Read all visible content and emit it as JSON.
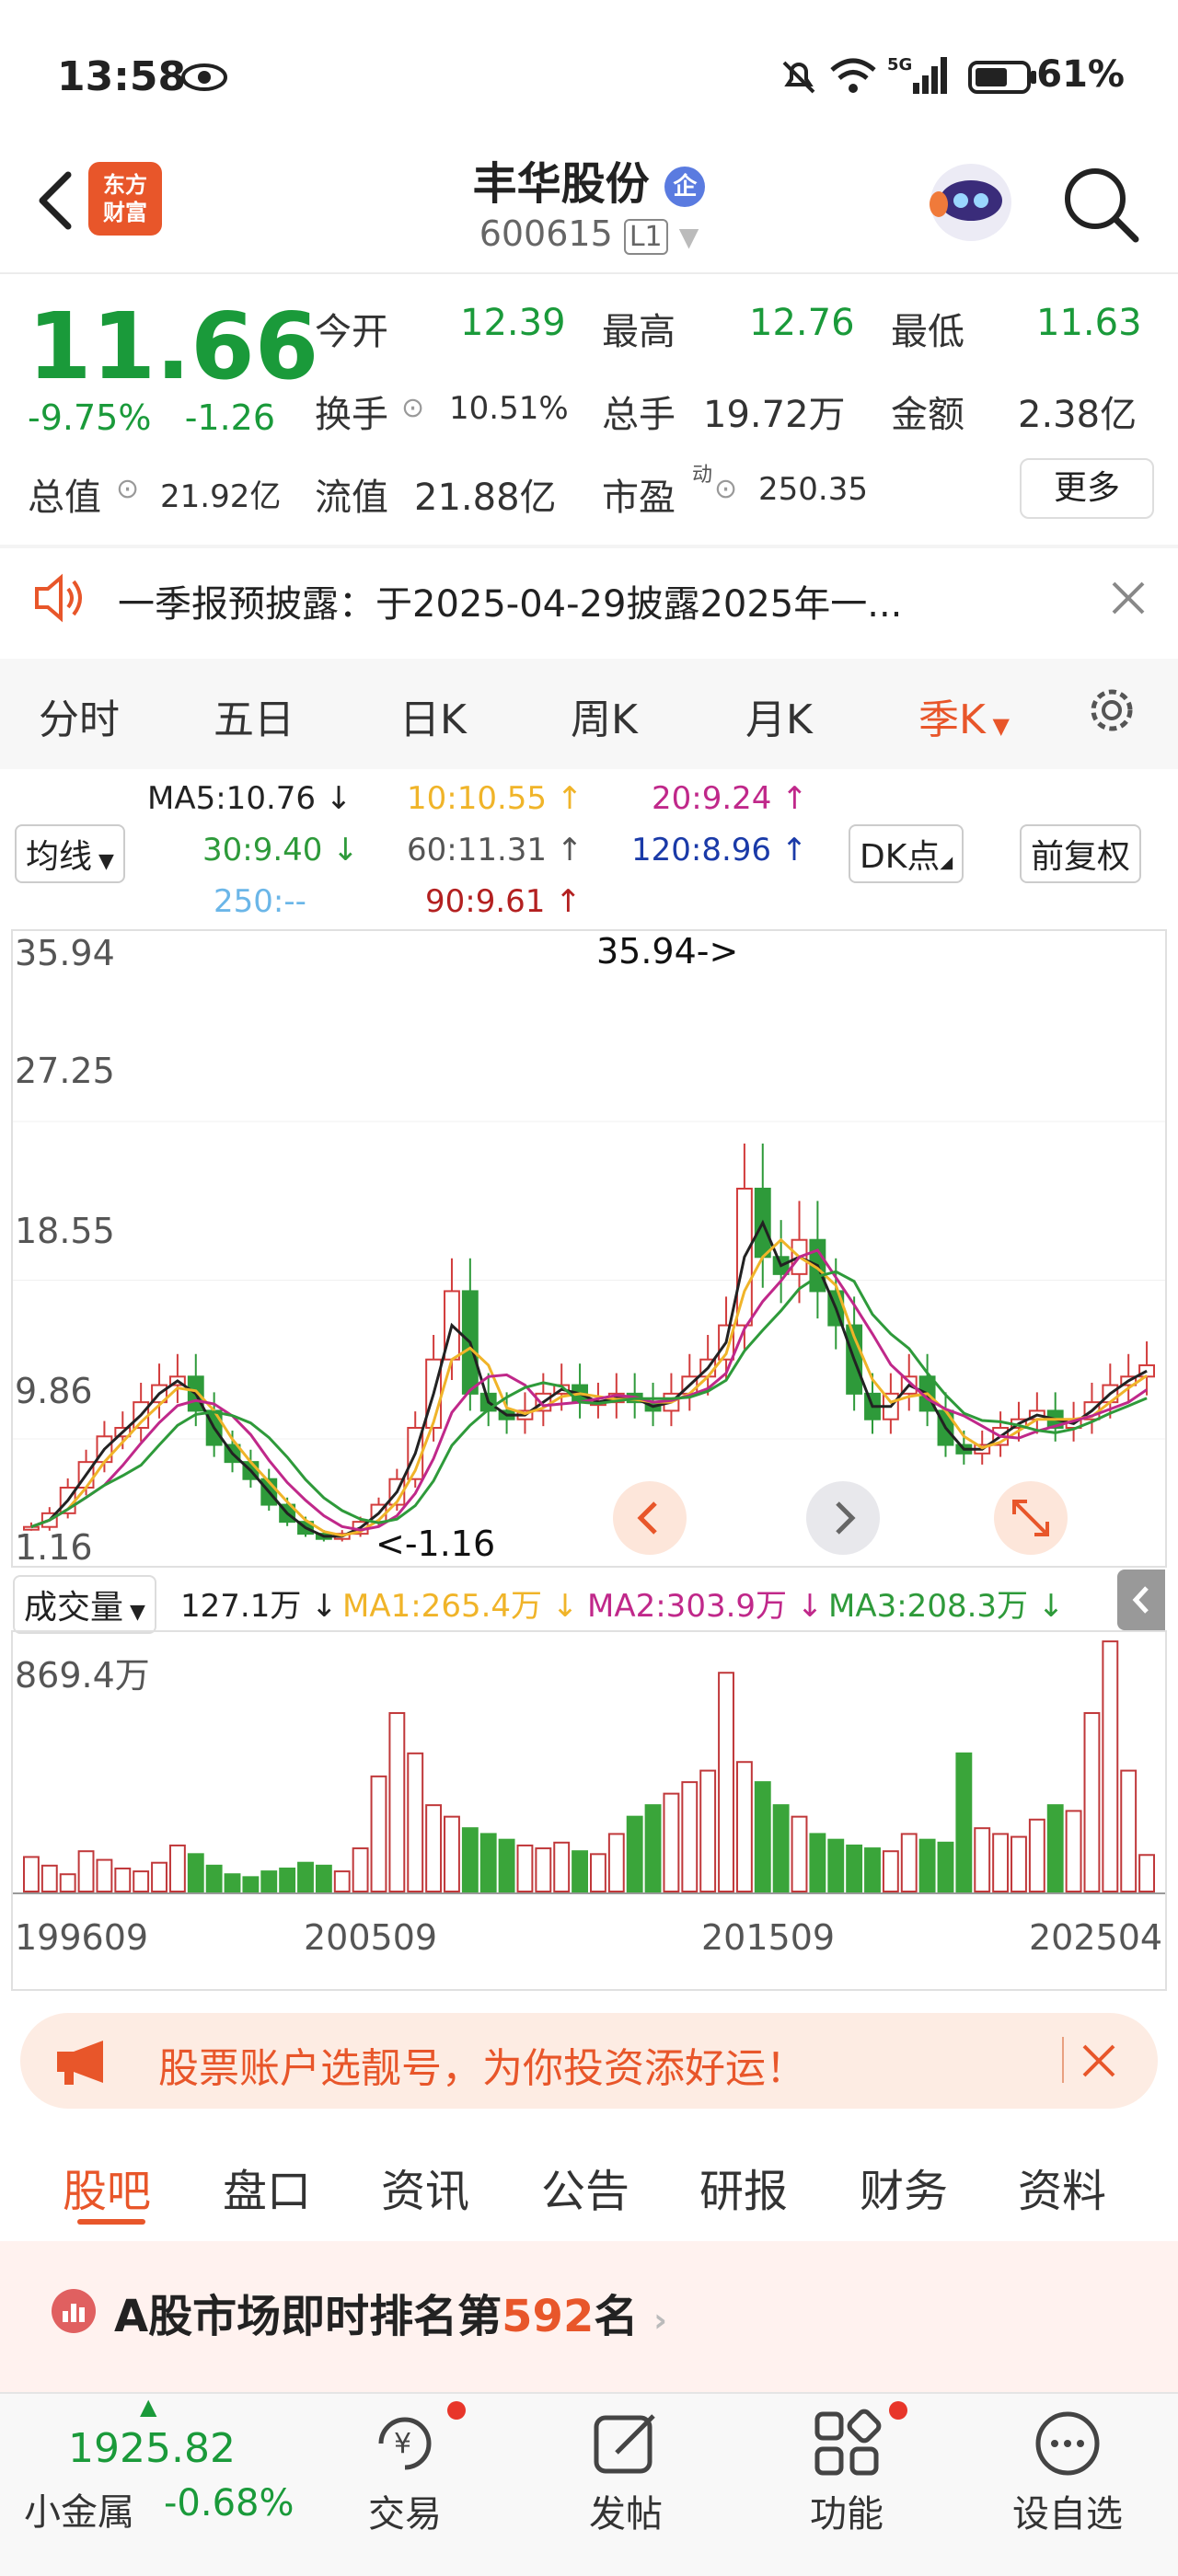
{
  "status": {
    "time": "13:58",
    "battery": "61%",
    "network": "5G"
  },
  "header": {
    "name": "丰华股份",
    "badge": "企",
    "code": "600615",
    "level": "L1",
    "logo_line1": "东方",
    "logo_line2": "财富"
  },
  "quote": {
    "price": "11.66",
    "pct": "-9.75%",
    "change": "-1.26",
    "open_lbl": "今开",
    "open": "12.39",
    "high_lbl": "最高",
    "high": "12.76",
    "low_lbl": "最低",
    "low": "11.63",
    "turnover_lbl": "换手",
    "turnover": "10.51%",
    "volume_lbl": "总手",
    "volume": "19.72万",
    "amount_lbl": "金额",
    "amount": "2.38亿",
    "mcap_lbl": "总值",
    "mcap": "21.92亿",
    "float_lbl": "流值",
    "float": "21.88亿",
    "pe_lbl": "市盈",
    "pe_sup": "动",
    "pe": "250.35",
    "more": "更多"
  },
  "notice": {
    "text": "一季报预披露：于2025-04-29披露2025年一..."
  },
  "period_tabs": [
    "分时",
    "五日",
    "日K",
    "周K",
    "月K",
    "季K"
  ],
  "ma_legend": {
    "selector": "均线",
    "ma5": "MA5:10.76",
    "ma10": "10:10.55",
    "ma20": "20:9.24",
    "ma30": "30:9.40",
    "ma60": "60:11.31",
    "ma120": "120:8.96",
    "ma250": "250:--",
    "ma90": "90:9.61",
    "dk": "DK点",
    "adjust": "前复权",
    "colors": {
      "ma5": "#222222",
      "ma10": "#f0b429",
      "ma20": "#c0288a",
      "ma30": "#2e9a3a",
      "ma60": "#555555",
      "ma120": "#1a3aa8",
      "ma250": "#6bb6e8",
      "ma90": "#b32020"
    }
  },
  "chart_data": {
    "type": "candlestick",
    "y_ticks": [
      "35.94",
      "27.25",
      "18.55",
      "9.86"
    ],
    "max_label": "35.94->",
    "min_label": "<-1.16",
    "low_tick": "1.16",
    "x_ticks": [
      "199609",
      "200509",
      "201509",
      "202504"
    ],
    "close_series": [
      2.2,
      3.0,
      4.5,
      6.0,
      7.5,
      8.0,
      9.5,
      10.5,
      11.0,
      9.0,
      7.0,
      6.0,
      5.0,
      3.5,
      2.5,
      1.8,
      1.5,
      1.8,
      2.5,
      3.5,
      5.0,
      8.0,
      12.0,
      16.0,
      10.0,
      9.0,
      8.5,
      9.0,
      10.0,
      10.5,
      9.5,
      9.5,
      10.0,
      9.5,
      9.0,
      10.0,
      11.0,
      12.0,
      14.0,
      22.0,
      18.0,
      17.0,
      19.0,
      16.0,
      14.0,
      10.0,
      8.5,
      10.0,
      11.0,
      9.0,
      7.0,
      6.5,
      7.0,
      8.0,
      8.5,
      9.0,
      8.0,
      8.5,
      9.5,
      10.5,
      11.0,
      11.66
    ]
  },
  "volume": {
    "selector": "成交量",
    "current": "127.1万",
    "ma1": "MA1:265.4万",
    "ma2": "MA2:303.9万",
    "ma3": "MA3:208.3万",
    "max_label": "869.4万",
    "values": [
      120,
      90,
      60,
      140,
      110,
      80,
      70,
      100,
      160,
      130,
      90,
      60,
      50,
      70,
      80,
      100,
      90,
      70,
      150,
      400,
      620,
      480,
      300,
      260,
      220,
      200,
      180,
      160,
      150,
      170,
      140,
      130,
      200,
      260,
      300,
      340,
      380,
      420,
      760,
      450,
      380,
      300,
      260,
      200,
      180,
      160,
      150,
      140,
      200,
      180,
      170,
      480,
      220,
      200,
      190,
      250,
      300,
      280,
      620,
      869,
      420,
      127
    ]
  },
  "ad": {
    "text": "股票账户选靓号，为你投资添好运！"
  },
  "content_tabs": [
    "股吧",
    "盘口",
    "资讯",
    "公告",
    "研报",
    "财务",
    "资料"
  ],
  "rank": {
    "prefix": "A股市场即时排名第",
    "num": "592",
    "suffix": "名"
  },
  "bottom": {
    "index_value": "1925.82",
    "index_name": "小金属",
    "index_pct": "-0.68%",
    "nav": [
      "交易",
      "发帖",
      "功能",
      "设自选"
    ]
  }
}
